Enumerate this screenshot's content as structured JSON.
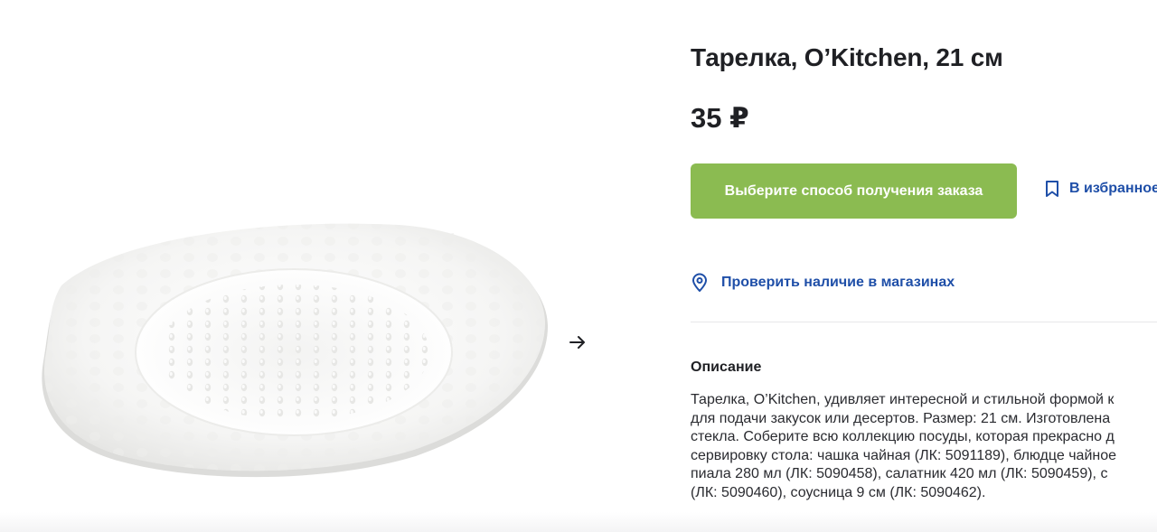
{
  "product": {
    "title": "Тарелка, O’Kitchen, 21 см",
    "price": "35 ₽",
    "image_icon": "plate-image"
  },
  "gallery": {
    "next_icon": "arrow-right-icon"
  },
  "actions": {
    "order_button": "Выберите способ получения заказа",
    "favorite_label": "В избранное",
    "availability_label": "Проверить наличие в магазинах"
  },
  "description": {
    "heading": "Описание",
    "lines": [
      "Тарелка, O’Kitchen, удивляет интересной и стильной формой к",
      "для подачи закусок или десертов. Размер: 21 см. Изготовлена",
      "стекла. Соберите всю коллекцию посуды, которая прекрасно д",
      "сервировку стола: чашка чайная (ЛК: 5091189), блюдце чайное",
      "пиала 280 мл (ЛК: 5090458), салатник 420 мл (ЛК: 5090459), с",
      "(ЛК: 5090460), соусница 9 см (ЛК: 5090462)."
    ]
  },
  "colors": {
    "accent_green": "#8bbb51",
    "link_blue": "#1f4fa8",
    "text": "#1f2024"
  }
}
